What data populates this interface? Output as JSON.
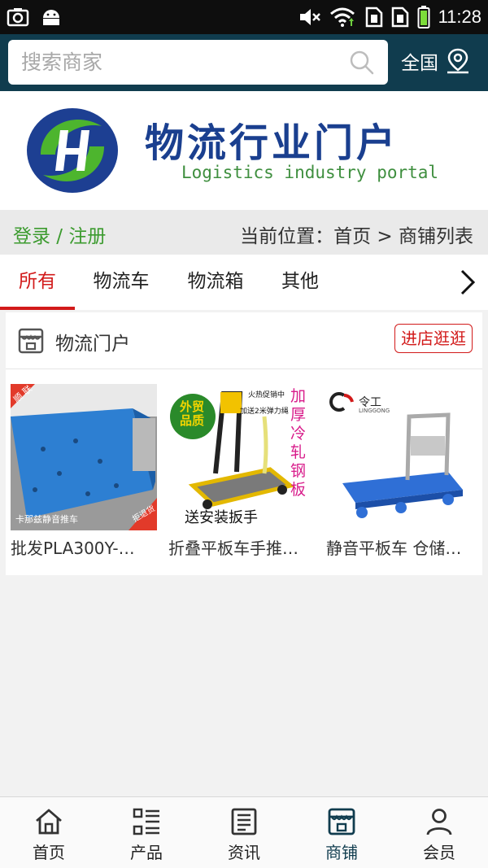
{
  "status_bar": {
    "time": "11:28",
    "icons": [
      "screenshot-icon",
      "android-icon",
      "mute-icon",
      "wifi-icon",
      "sim1-icon",
      "sim2-icon",
      "battery-icon"
    ]
  },
  "header": {
    "search_placeholder": "搜索商家",
    "region_label": "全国",
    "background_color": "#103c4e"
  },
  "banner": {
    "title": "物流行业门户",
    "subtitle": "Logistics industry portal"
  },
  "crumbbar": {
    "login_label": "登录 / 注册",
    "location": "当前位置：首页 > 商铺列表"
  },
  "tabs": [
    {
      "label": "所有",
      "active": true
    },
    {
      "label": "物流车",
      "active": false
    },
    {
      "label": "物流箱",
      "active": false
    },
    {
      "label": "其他",
      "active": false
    }
  ],
  "shop": {
    "name": "物流门户",
    "visit_label": "进店逛逛",
    "products": [
      {
        "title": "批发PLA300Y-…",
        "img_text_1": "卡那兹静音推车",
        "img_badge": "顺 联",
        "img_tag": "拒退货"
      },
      {
        "title": "折叠平板车手推…",
        "img_text_1": "送安装扳手",
        "img_badge": "外贸品质",
        "img_vertical": "加厚冷轧钢板",
        "img_promo_1": "火热促销中",
        "img_promo_2": "加送2米弹力绳"
      },
      {
        "title": "静音平板车 仓储…",
        "img_brand": "令工",
        "img_brand_sub": "LINGGONG"
      }
    ]
  },
  "bottom_nav": [
    {
      "label": "首页",
      "icon": "home-icon",
      "active": false
    },
    {
      "label": "产品",
      "icon": "product-list-icon",
      "active": false
    },
    {
      "label": "资讯",
      "icon": "news-icon",
      "active": false
    },
    {
      "label": "商铺",
      "icon": "store-icon",
      "active": true
    },
    {
      "label": "会员",
      "icon": "member-icon",
      "active": false
    }
  ],
  "colors": {
    "accent_red": "#d21a1a",
    "login_green": "#3c9b2f",
    "brand_blue": "#1a3f8f"
  }
}
